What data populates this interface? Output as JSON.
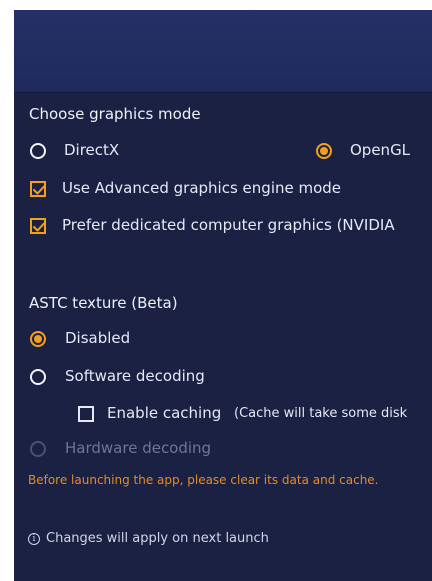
{
  "graphics": {
    "heading": "Choose graphics mode",
    "options": [
      {
        "label": "DirectX",
        "selected": false
      },
      {
        "label": "OpenGL",
        "selected": true
      }
    ],
    "checkboxes": [
      {
        "label": "Use Advanced graphics engine mode",
        "checked": true
      },
      {
        "label": "Prefer dedicated computer graphics (NVIDIA",
        "checked": true
      }
    ]
  },
  "astc": {
    "heading": "ASTC texture (Beta)",
    "options": [
      {
        "label": "Disabled",
        "selected": true
      },
      {
        "label": "Software decoding",
        "selected": false
      },
      {
        "label": "Hardware decoding",
        "selected": false,
        "disabled": true
      }
    ],
    "caching": {
      "label": "Enable caching",
      "note": "(Cache will take some disk",
      "checked": false
    }
  },
  "warning": "Before launching the app, please clear its data and cache.",
  "footer": {
    "info_icon": "i",
    "text": "Changes will apply on next launch"
  },
  "colors": {
    "background": "#1a2142",
    "header": "#253066",
    "accent": "#f4a01e",
    "warning": "#e48a2b"
  }
}
